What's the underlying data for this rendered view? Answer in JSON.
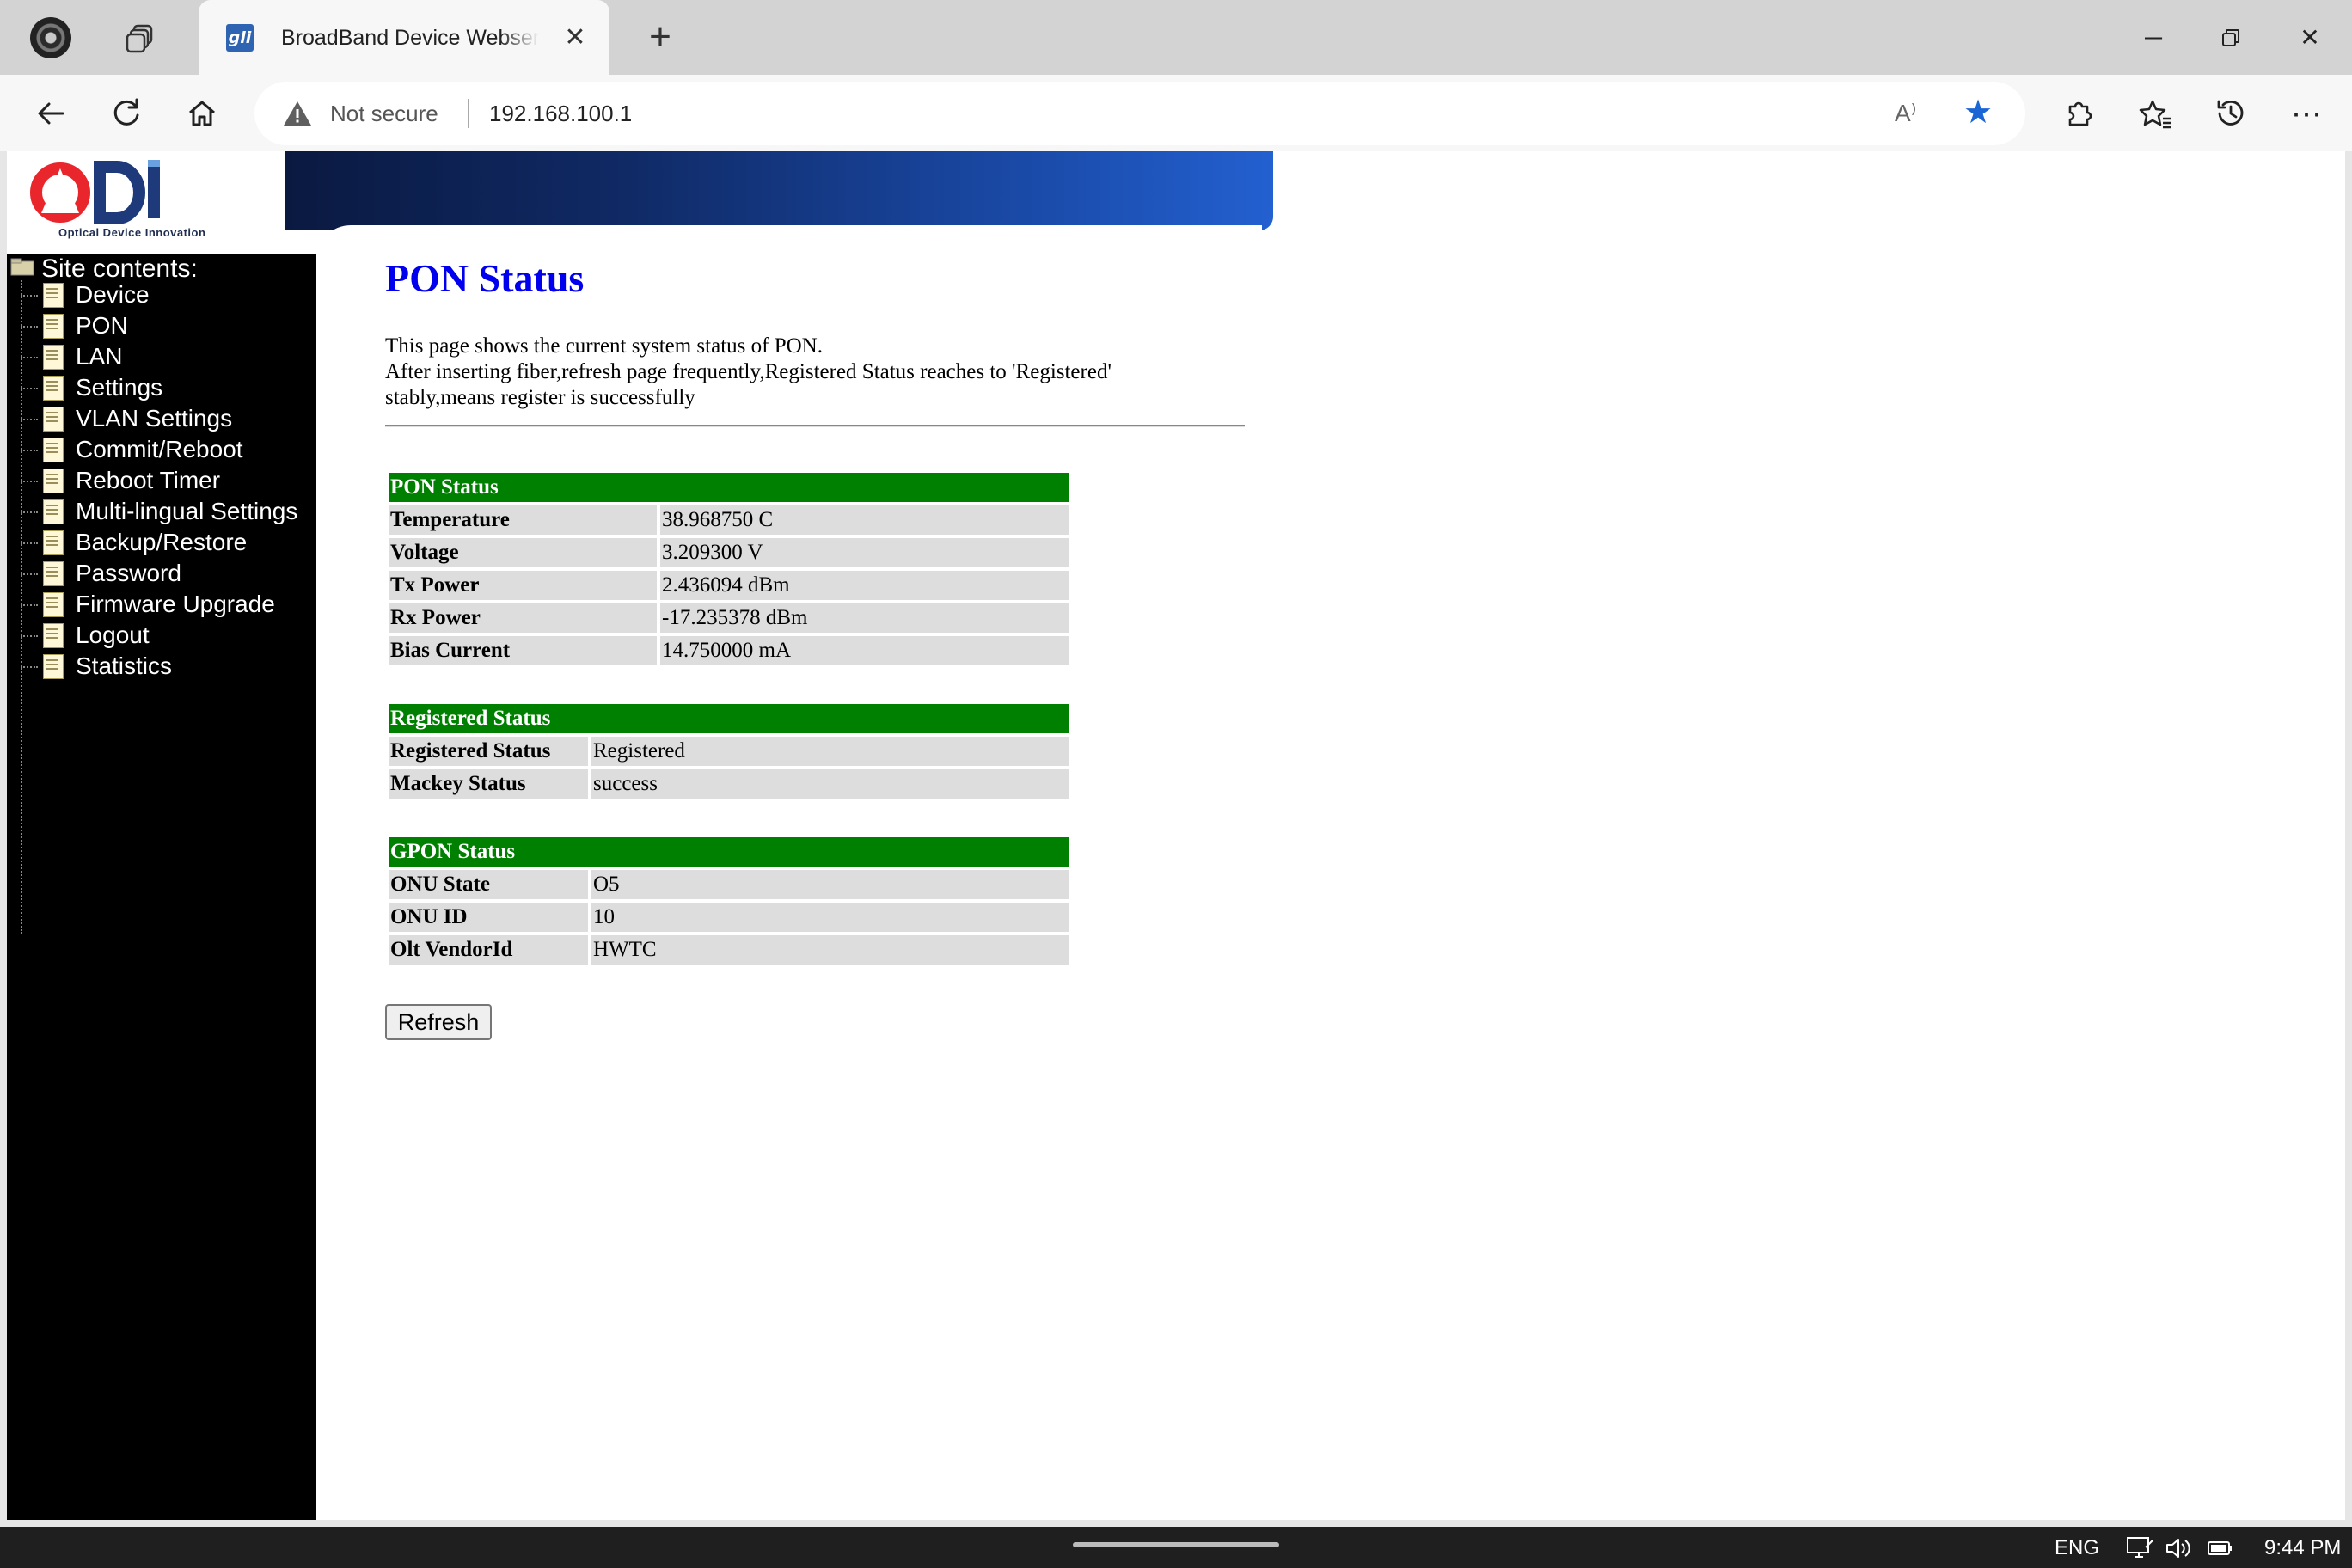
{
  "browser": {
    "tab_title": "BroadBand Device Webserver",
    "tab_favicon_text": "gli",
    "address": {
      "security_label": "Not secure",
      "url": "192.168.100.1"
    },
    "read_aloud_label": "A⁾"
  },
  "logo": {
    "brand": "ODI",
    "tagline": "Optical Device Innovation",
    "brand_color": "#e8262c",
    "accent_color": "#1e3a7a"
  },
  "sidebar": {
    "title": "Site contents:",
    "items": [
      {
        "label": "Device"
      },
      {
        "label": "PON"
      },
      {
        "label": "LAN"
      },
      {
        "label": "Settings"
      },
      {
        "label": "VLAN Settings"
      },
      {
        "label": "Commit/Reboot"
      },
      {
        "label": "Reboot Timer"
      },
      {
        "label": "Multi-lingual Settings"
      },
      {
        "label": "Backup/Restore"
      },
      {
        "label": "Password"
      },
      {
        "label": "Firmware Upgrade"
      },
      {
        "label": "Logout"
      },
      {
        "label": "Statistics"
      }
    ]
  },
  "main": {
    "title": "PON Status",
    "description": [
      "This page shows the current system status of PON.",
      "After inserting fiber,refresh page frequently,Registered Status reaches to 'Registered'",
      "stably,means register is successfully"
    ],
    "pon_status": {
      "header": "PON Status",
      "rows": [
        {
          "label": "Temperature",
          "value": "38.968750 C"
        },
        {
          "label": "Voltage",
          "value": "3.209300 V"
        },
        {
          "label": "Tx Power",
          "value": "2.436094 dBm"
        },
        {
          "label": "Rx Power",
          "value": "-17.235378 dBm"
        },
        {
          "label": "Bias Current",
          "value": "14.750000 mA"
        }
      ]
    },
    "registered_status": {
      "header": "Registered Status",
      "rows": [
        {
          "label": "Registered Status",
          "value": "Registered"
        },
        {
          "label": "Mackey Status",
          "value": "success"
        }
      ]
    },
    "gpon_status": {
      "header": "GPON Status",
      "rows": [
        {
          "label": "ONU State",
          "value": "O5"
        },
        {
          "label": "ONU ID",
          "value": "10"
        },
        {
          "label": "Olt VendorId",
          "value": "HWTC"
        }
      ]
    },
    "refresh_label": "Refresh",
    "header_color": "#008000",
    "title_color": "#0000ee"
  },
  "taskbar": {
    "language": "ENG",
    "time": "9:44 PM"
  }
}
